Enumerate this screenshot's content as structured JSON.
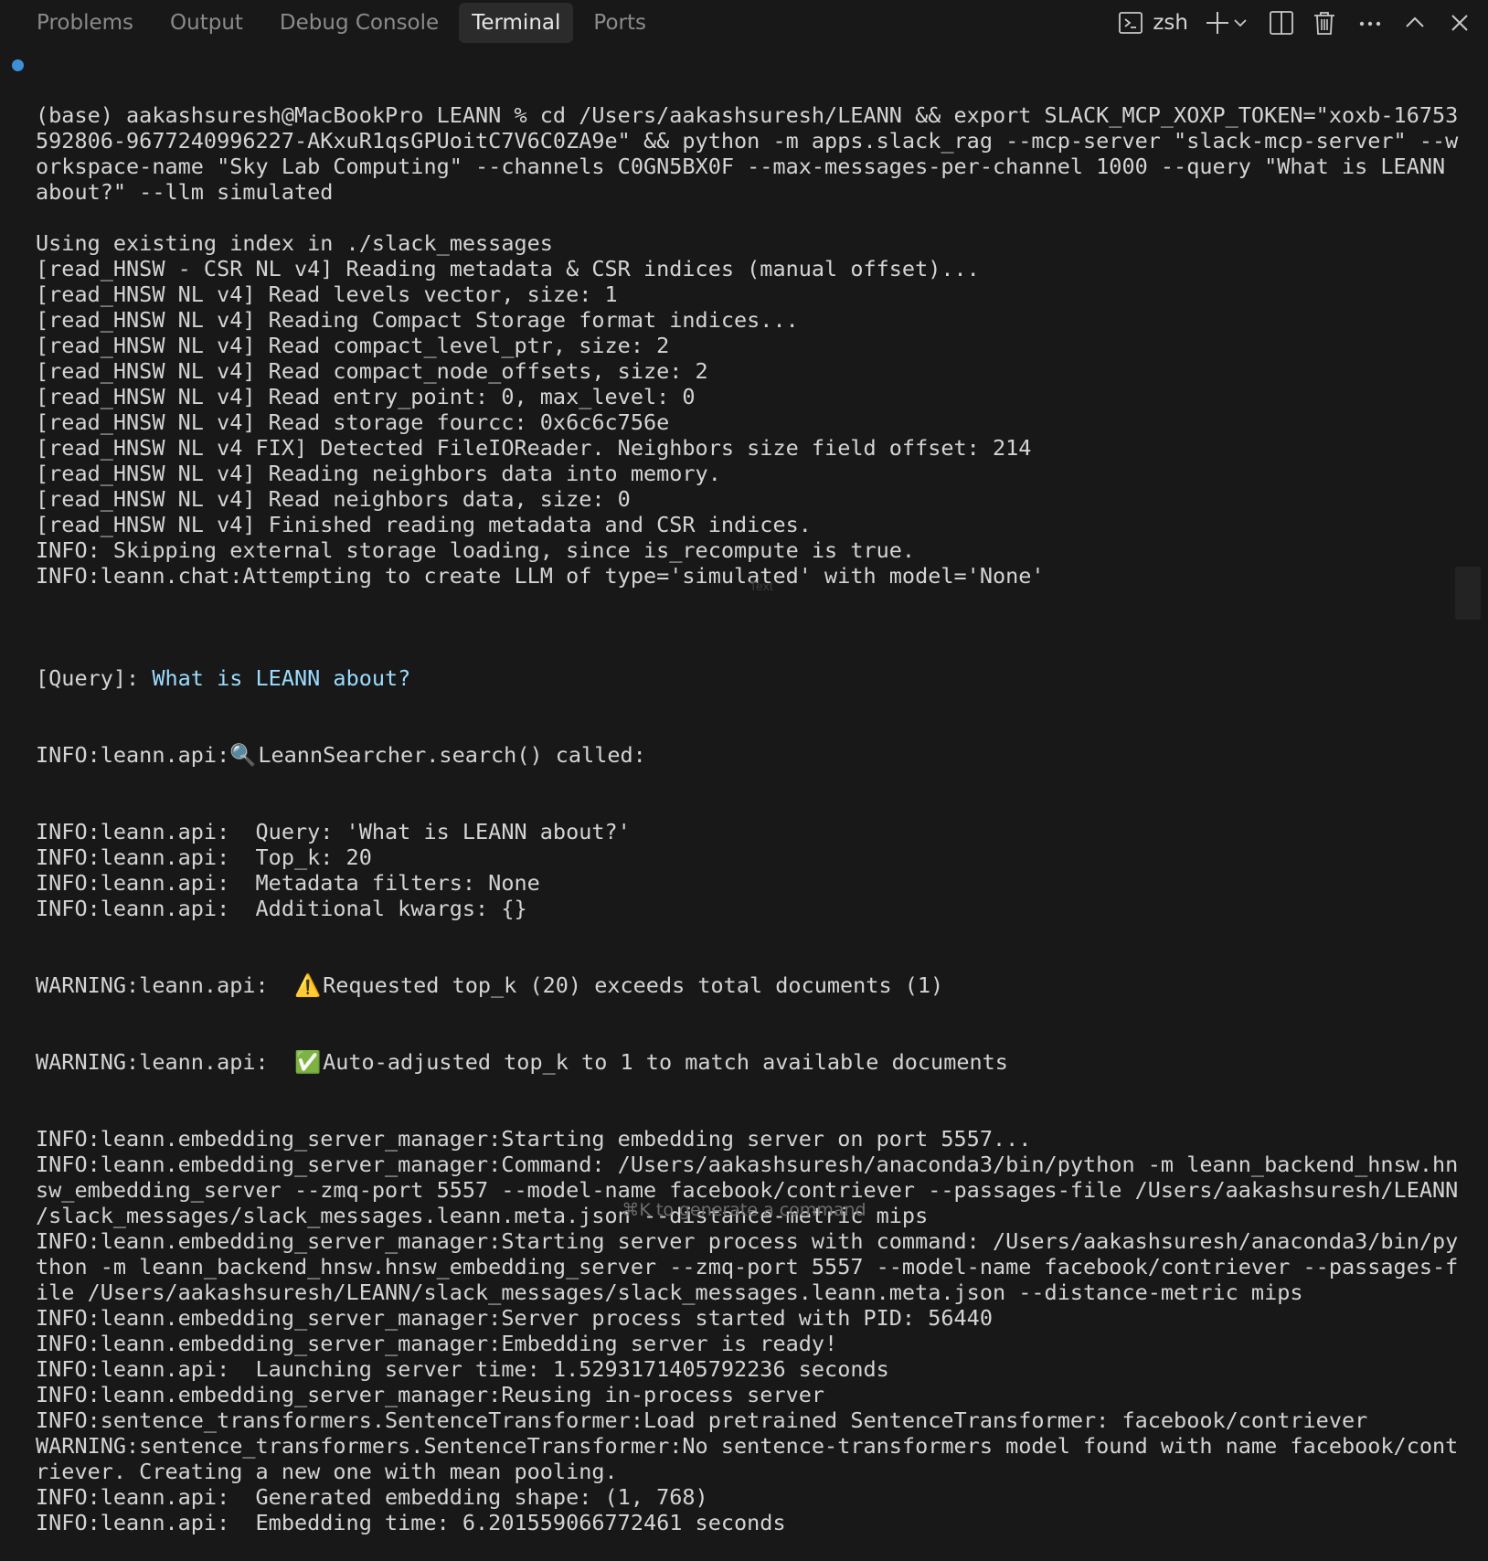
{
  "panel": {
    "tabs": [
      {
        "label": "Problems"
      },
      {
        "label": "Output"
      },
      {
        "label": "Debug Console"
      },
      {
        "label": "Terminal"
      },
      {
        "label": "Ports"
      }
    ],
    "active_tab": "Terminal",
    "shell_name": "zsh",
    "icons": [
      "terminal-icon",
      "plus-icon",
      "chevron-down-icon",
      "split-icon",
      "trash-icon",
      "more-icon",
      "chevron-up-icon",
      "close-icon"
    ]
  },
  "terminal": {
    "lines": [
      "(base) aakashsuresh@MacBookPro LEANN % cd /Users/aakashsuresh/LEANN && export SLACK_MCP_XOXP_TOKEN=\"xoxb-16753",
      "592806-9677240996227-AKxuR1qsGPUoitC7V6C0ZA9e\" && python -m apps.slack_rag --mcp-server \"slack-mcp-server\" --w",
      "orkspace-name \"Sky Lab Computing\" --channels C0GN5BX0F --max-messages-per-channel 1000 --query \"What is LEANN",
      "about?\" --llm simulated",
      "",
      "Using existing index in ./slack_messages",
      "[read_HNSW - CSR NL v4] Reading metadata & CSR indices (manual offset)...",
      "[read_HNSW NL v4] Read levels vector, size: 1",
      "[read_HNSW NL v4] Reading Compact Storage format indices...",
      "[read_HNSW NL v4] Read compact_level_ptr, size: 2",
      "[read_HNSW NL v4] Read compact_node_offsets, size: 2",
      "[read_HNSW NL v4] Read entry_point: 0, max_level: 0",
      "[read_HNSW NL v4] Read storage fourcc: 0x6c6c756e",
      "[read_HNSW NL v4 FIX] Detected FileIOReader. Neighbors size field offset: 214",
      "[read_HNSW NL v4] Reading neighbors data into memory.",
      "[read_HNSW NL v4] Read neighbors data, size: 0",
      "[read_HNSW NL v4] Finished reading metadata and CSR indices.",
      "INFO: Skipping external storage loading, since is_recompute is true.",
      "INFO:leann.chat:Attempting to create LLM of type='simulated' with model='None'",
      ""
    ],
    "query_prefix": "[Query]: ",
    "query_text": "What is LEANN about?",
    "search_prefix": "INFO:leann.api:",
    "search_emoji": "🔍",
    "search_suffix": " LeannSearcher.search() called:",
    "lines_after_search": [
      "INFO:leann.api:  Query: 'What is LEANN about?'",
      "INFO:leann.api:  Top_k: 20",
      "INFO:leann.api:  Metadata filters: None",
      "INFO:leann.api:  Additional kwargs: {}"
    ],
    "warn1_prefix": "WARNING:leann.api:  ",
    "warn1_emoji": "⚠️",
    "warn1_suffix": " Requested top_k (20) exceeds total documents (1)",
    "warn2_prefix": "WARNING:leann.api:  ",
    "warn2_emoji": "✅",
    "warn2_suffix": " Auto-adjusted top_k to 1 to match available documents",
    "lines_tail": [
      "INFO:leann.embedding_server_manager:Starting embedding server on port 5557...",
      "INFO:leann.embedding_server_manager:Command: /Users/aakashsuresh/anaconda3/bin/python -m leann_backend_hnsw.hn",
      "sw_embedding_server --zmq-port 5557 --model-name facebook/contriever --passages-file /Users/aakashsuresh/LEANN",
      "/slack_messages/slack_messages.leann.meta.json --distance-metric mips",
      "INFO:leann.embedding_server_manager:Starting server process with command: /Users/aakashsuresh/anaconda3/bin/py",
      "thon -m leann_backend_hnsw.hnsw_embedding_server --zmq-port 5557 --model-name facebook/contriever --passages-f",
      "ile /Users/aakashsuresh/LEANN/slack_messages/slack_messages.leann.meta.json --distance-metric mips",
      "INFO:leann.embedding_server_manager:Server process started with PID: 56440",
      "INFO:leann.embedding_server_manager:Embedding server is ready!",
      "INFO:leann.api:  Launching server time: 1.5293171405792236 seconds",
      "INFO:leann.embedding_server_manager:Reusing in-process server",
      "INFO:sentence_transformers.SentenceTransformer:Load pretrained SentenceTransformer: facebook/contriever",
      "WARNING:sentence_transformers.SentenceTransformer:No sentence-transformers model found with name facebook/cont",
      "riever. Creating a new one with mean pooling.",
      "INFO:leann.api:  Generated embedding shape: (1, 768)",
      "INFO:leann.api:  Embedding time: 6.201559066772461 seconds"
    ],
    "ghost_label": "Text",
    "hint": "⌘K to generate a command"
  },
  "colors": {
    "background": "#181818",
    "active_tab_bg": "#2b2b2b",
    "query_highlight": "#9cdcfe",
    "command_marker": "#3d8fd6"
  }
}
